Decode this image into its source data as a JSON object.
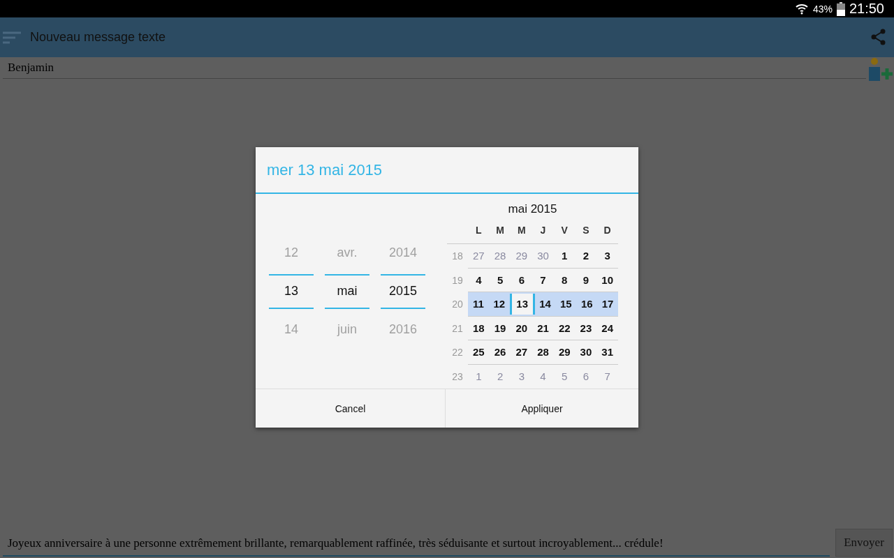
{
  "status_bar": {
    "battery": "43%",
    "time": "21:50"
  },
  "app_bar": {
    "title": "Nouveau message texte"
  },
  "recipient": {
    "value": "Benjamin"
  },
  "dialog": {
    "title": "mer 13 mai 2015",
    "spinners": [
      {
        "prev": "12",
        "current": "13",
        "next": "14"
      },
      {
        "prev": "avr.",
        "current": "mai",
        "next": "juin"
      },
      {
        "prev": "2014",
        "current": "2015",
        "next": "2016"
      }
    ],
    "calendar": {
      "month_title": "mai 2015",
      "weekdays": [
        "L",
        "M",
        "M",
        "J",
        "V",
        "S",
        "D"
      ],
      "weeks": [
        {
          "number": "18",
          "selected": false,
          "days": [
            {
              "label": "27",
              "in_month": false,
              "selected": false
            },
            {
              "label": "28",
              "in_month": false,
              "selected": false
            },
            {
              "label": "29",
              "in_month": false,
              "selected": false
            },
            {
              "label": "30",
              "in_month": false,
              "selected": false
            },
            {
              "label": "1",
              "in_month": true,
              "selected": false
            },
            {
              "label": "2",
              "in_month": true,
              "selected": false
            },
            {
              "label": "3",
              "in_month": true,
              "selected": false
            }
          ]
        },
        {
          "number": "19",
          "selected": false,
          "days": [
            {
              "label": "4",
              "in_month": true,
              "selected": false
            },
            {
              "label": "5",
              "in_month": true,
              "selected": false
            },
            {
              "label": "6",
              "in_month": true,
              "selected": false
            },
            {
              "label": "7",
              "in_month": true,
              "selected": false
            },
            {
              "label": "8",
              "in_month": true,
              "selected": false
            },
            {
              "label": "9",
              "in_month": true,
              "selected": false
            },
            {
              "label": "10",
              "in_month": true,
              "selected": false
            }
          ]
        },
        {
          "number": "20",
          "selected": true,
          "days": [
            {
              "label": "11",
              "in_month": true,
              "selected": false
            },
            {
              "label": "12",
              "in_month": true,
              "selected": false
            },
            {
              "label": "13",
              "in_month": true,
              "selected": true
            },
            {
              "label": "14",
              "in_month": true,
              "selected": false
            },
            {
              "label": "15",
              "in_month": true,
              "selected": false
            },
            {
              "label": "16",
              "in_month": true,
              "selected": false
            },
            {
              "label": "17",
              "in_month": true,
              "selected": false
            }
          ]
        },
        {
          "number": "21",
          "selected": false,
          "days": [
            {
              "label": "18",
              "in_month": true,
              "selected": false
            },
            {
              "label": "19",
              "in_month": true,
              "selected": false
            },
            {
              "label": "20",
              "in_month": true,
              "selected": false
            },
            {
              "label": "21",
              "in_month": true,
              "selected": false
            },
            {
              "label": "22",
              "in_month": true,
              "selected": false
            },
            {
              "label": "23",
              "in_month": true,
              "selected": false
            },
            {
              "label": "24",
              "in_month": true,
              "selected": false
            }
          ]
        },
        {
          "number": "22",
          "selected": false,
          "days": [
            {
              "label": "25",
              "in_month": true,
              "selected": false
            },
            {
              "label": "26",
              "in_month": true,
              "selected": false
            },
            {
              "label": "27",
              "in_month": true,
              "selected": false
            },
            {
              "label": "28",
              "in_month": true,
              "selected": false
            },
            {
              "label": "29",
              "in_month": true,
              "selected": false
            },
            {
              "label": "30",
              "in_month": true,
              "selected": false
            },
            {
              "label": "31",
              "in_month": true,
              "selected": false
            }
          ]
        },
        {
          "number": "23",
          "selected": false,
          "days": [
            {
              "label": "1",
              "in_month": false,
              "selected": false
            },
            {
              "label": "2",
              "in_month": false,
              "selected": false
            },
            {
              "label": "3",
              "in_month": false,
              "selected": false
            },
            {
              "label": "4",
              "in_month": false,
              "selected": false
            },
            {
              "label": "5",
              "in_month": false,
              "selected": false
            },
            {
              "label": "6",
              "in_month": false,
              "selected": false
            },
            {
              "label": "7",
              "in_month": false,
              "selected": false
            }
          ]
        }
      ]
    },
    "buttons": [
      "Cancel",
      "Appliquer"
    ]
  },
  "message": {
    "value": "Joyeux anniversaire à une personne extrêmement brillante, remarquablement raffinée, très séduisante et surtout incroyablement... crédule!"
  },
  "send_button": {
    "label": "Envoyer"
  }
}
